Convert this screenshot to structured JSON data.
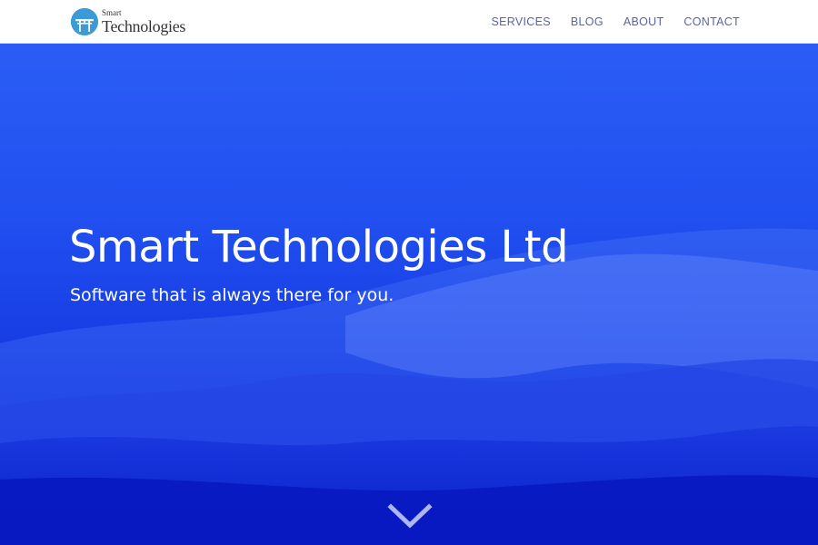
{
  "brand": {
    "logo_small": "Smart",
    "logo_big": "Technologies",
    "accent": "#3d9ad6"
  },
  "nav": {
    "items": [
      {
        "label": "SERVICES"
      },
      {
        "label": "BLOG"
      },
      {
        "label": "ABOUT"
      },
      {
        "label": "CONTACT"
      }
    ],
    "color": "#5a63a8"
  },
  "hero": {
    "title": "Smart Technologies Ltd",
    "subtitle": "Software that is always there for you.",
    "scroll_icon": "chevron-down-icon",
    "background_color": "#1847ec"
  }
}
